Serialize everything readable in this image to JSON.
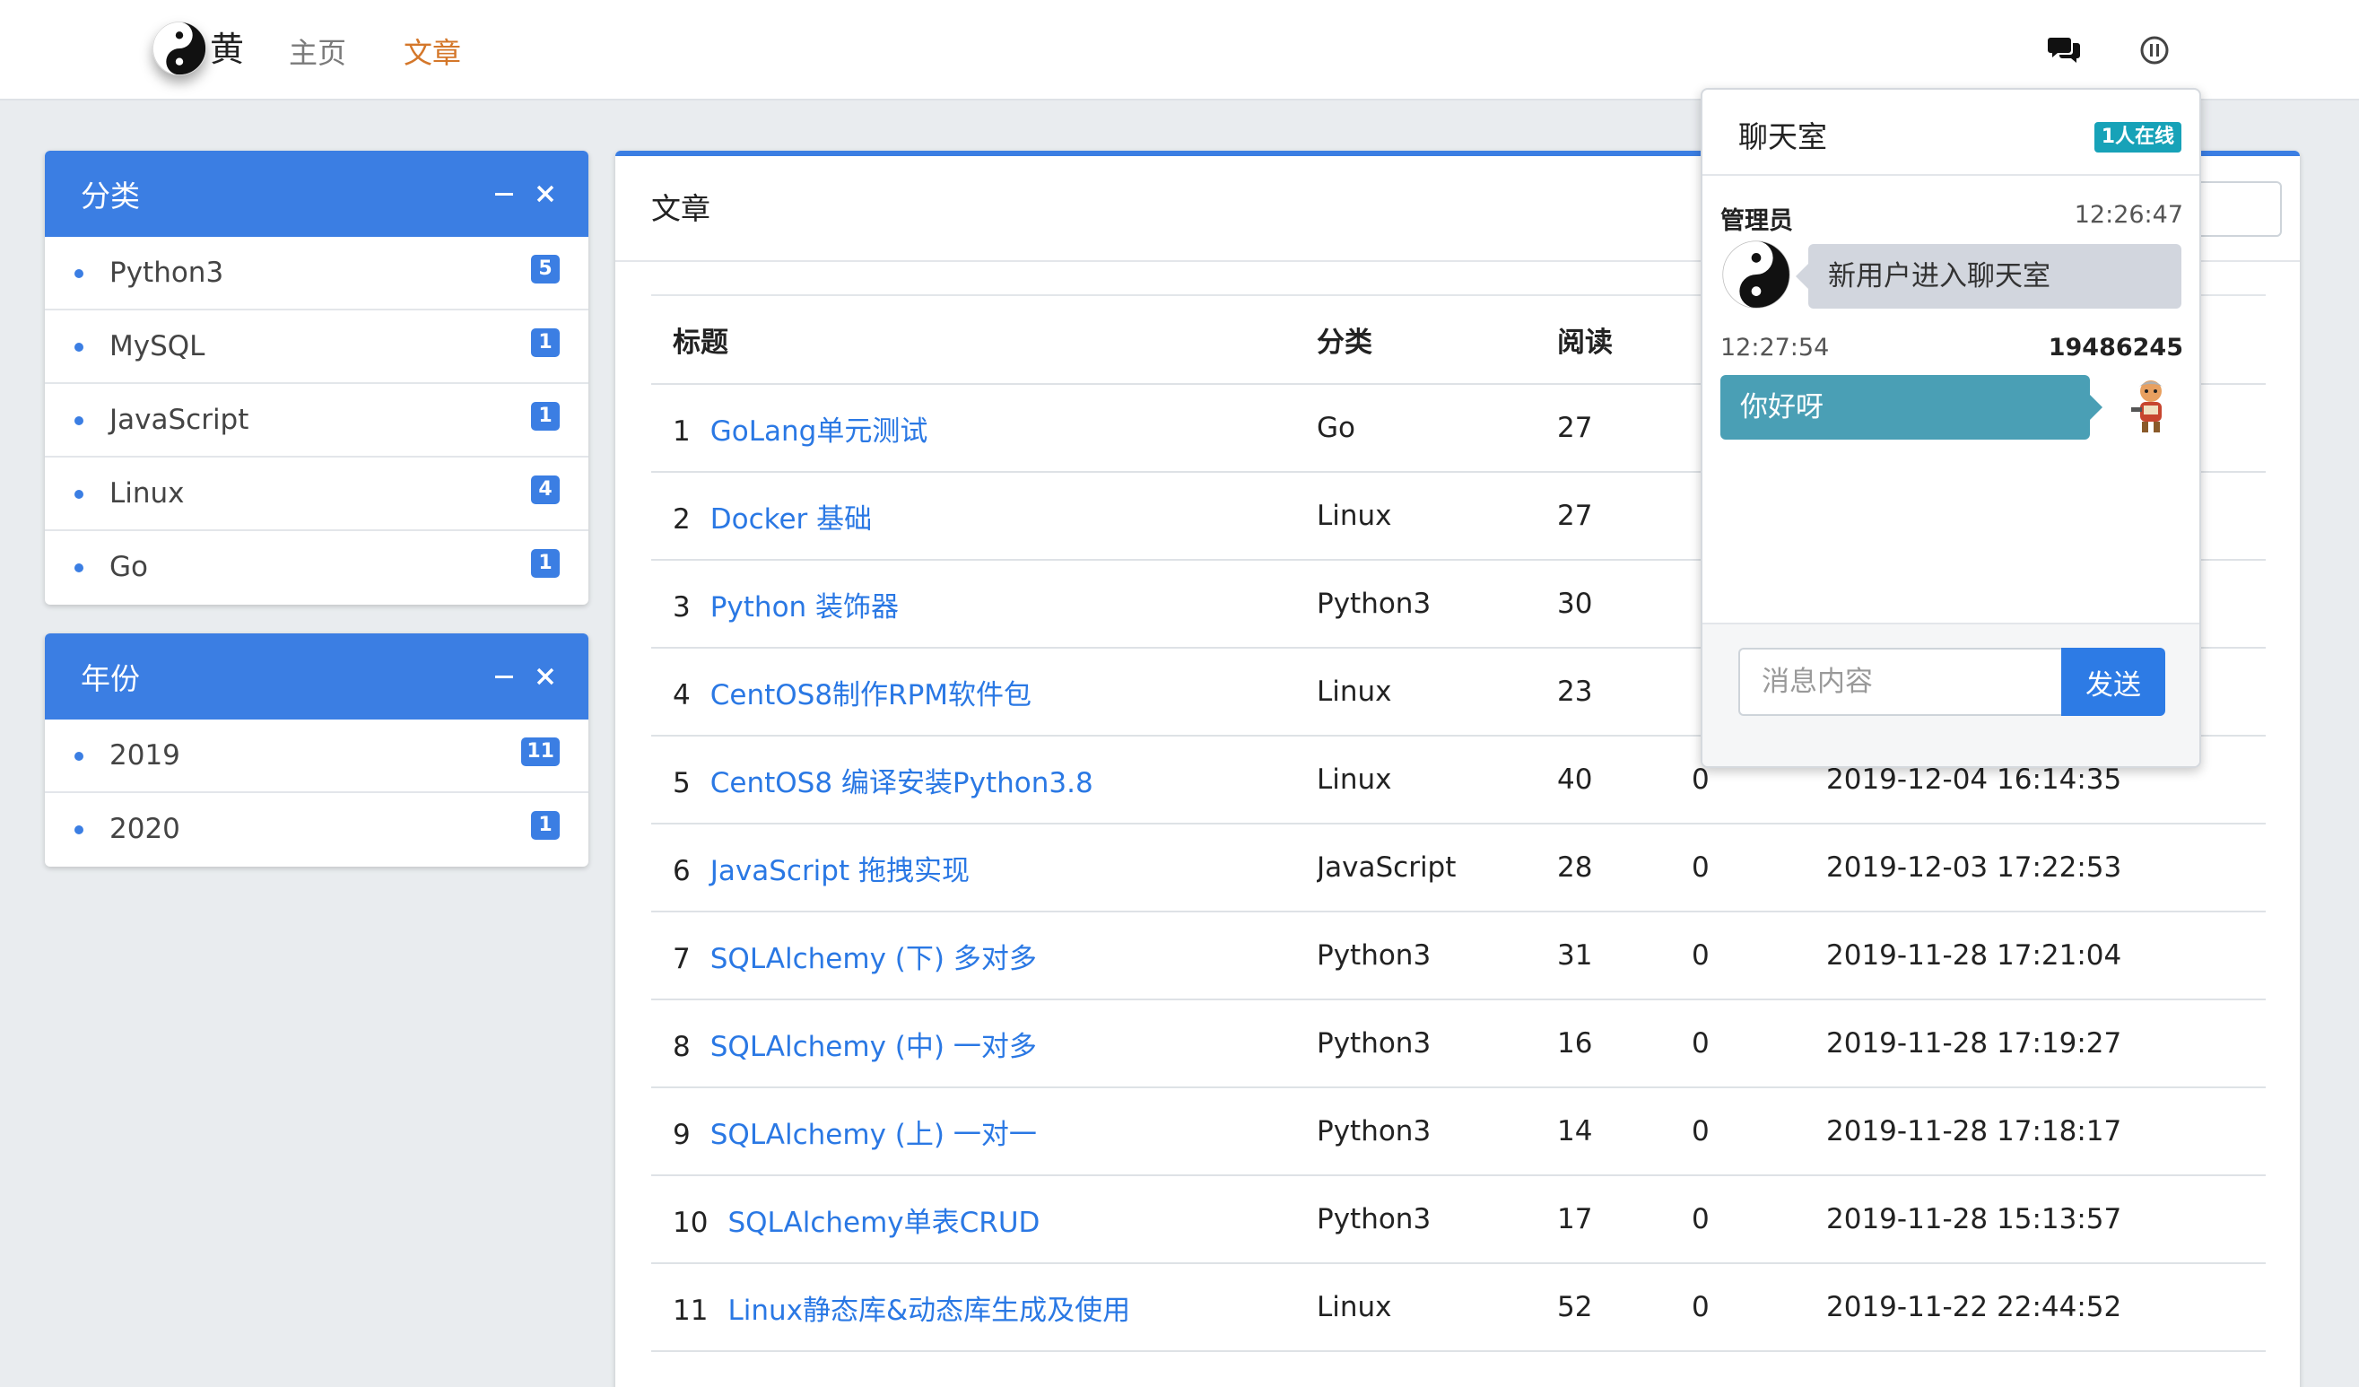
{
  "navbar": {
    "brand": "黄",
    "links": [
      "主页",
      "文章"
    ]
  },
  "sidebar": {
    "categories": {
      "title": "分类",
      "items": [
        {
          "label": "Python3",
          "count": "5"
        },
        {
          "label": "MySQL",
          "count": "1"
        },
        {
          "label": "JavaScript",
          "count": "1"
        },
        {
          "label": "Linux",
          "count": "4"
        },
        {
          "label": "Go",
          "count": "1"
        }
      ]
    },
    "years": {
      "title": "年份",
      "items": [
        {
          "label": "2019",
          "count": "11"
        },
        {
          "label": "2020",
          "count": "1"
        }
      ]
    }
  },
  "main": {
    "title": "文章",
    "table": {
      "headers": [
        "标题",
        "分类",
        "阅读",
        "",
        ""
      ],
      "rows": [
        {
          "idx": "1",
          "title": "GoLang单元测试",
          "category": "Go",
          "reads": "27",
          "comments": "",
          "date": ""
        },
        {
          "idx": "2",
          "title": "Docker 基础",
          "category": "Linux",
          "reads": "27",
          "comments": "",
          "date": ""
        },
        {
          "idx": "3",
          "title": "Python 装饰器",
          "category": "Python3",
          "reads": "30",
          "comments": "",
          "date": ""
        },
        {
          "idx": "4",
          "title": "CentOS8制作RPM软件包",
          "category": "Linux",
          "reads": "23",
          "comments": "",
          "date": ""
        },
        {
          "idx": "5",
          "title": "CentOS8 编译安装Python3.8",
          "category": "Linux",
          "reads": "40",
          "comments": "0",
          "date": "2019-12-04 16:14:35"
        },
        {
          "idx": "6",
          "title": "JavaScript 拖拽实现",
          "category": "JavaScript",
          "reads": "28",
          "comments": "0",
          "date": "2019-12-03 17:22:53"
        },
        {
          "idx": "7",
          "title": "SQLAlchemy (下) 多对多",
          "category": "Python3",
          "reads": "31",
          "comments": "0",
          "date": "2019-11-28 17:21:04"
        },
        {
          "idx": "8",
          "title": "SQLAlchemy (中) 一对多",
          "category": "Python3",
          "reads": "16",
          "comments": "0",
          "date": "2019-11-28 17:19:27"
        },
        {
          "idx": "9",
          "title": "SQLAlchemy (上) 一对一",
          "category": "Python3",
          "reads": "14",
          "comments": "0",
          "date": "2019-11-28 17:18:17"
        },
        {
          "idx": "10",
          "title": "SQLAlchemy单表CRUD",
          "category": "Python3",
          "reads": "17",
          "comments": "0",
          "date": "2019-11-28 15:13:57"
        },
        {
          "idx": "11",
          "title": "Linux静态库&动态库生成及使用",
          "category": "Linux",
          "reads": "52",
          "comments": "0",
          "date": "2019-11-22 22:44:52"
        }
      ]
    }
  },
  "chat": {
    "title": "聊天室",
    "online": "1人在线",
    "messages": [
      {
        "name": "管理员",
        "time": "12:26:47",
        "text": "新用户进入聊天室"
      },
      {
        "name": "19486245",
        "time": "12:27:54",
        "text": "你好呀"
      }
    ],
    "input_placeholder": "消息内容",
    "send_label": "发送"
  },
  "colors": {
    "primary": "#3b7ee3",
    "link": "#2a78e4",
    "active_nav": "#d4772a",
    "chat_self_bubble": "#4a9fb5",
    "chat_other_bubble": "#d2d6de",
    "online_badge": "#17a2b8"
  },
  "icons": [
    "yin-yang-logo-icon",
    "chat-bubbles-icon",
    "pause-circle-icon",
    "minimize-icon",
    "close-icon"
  ]
}
